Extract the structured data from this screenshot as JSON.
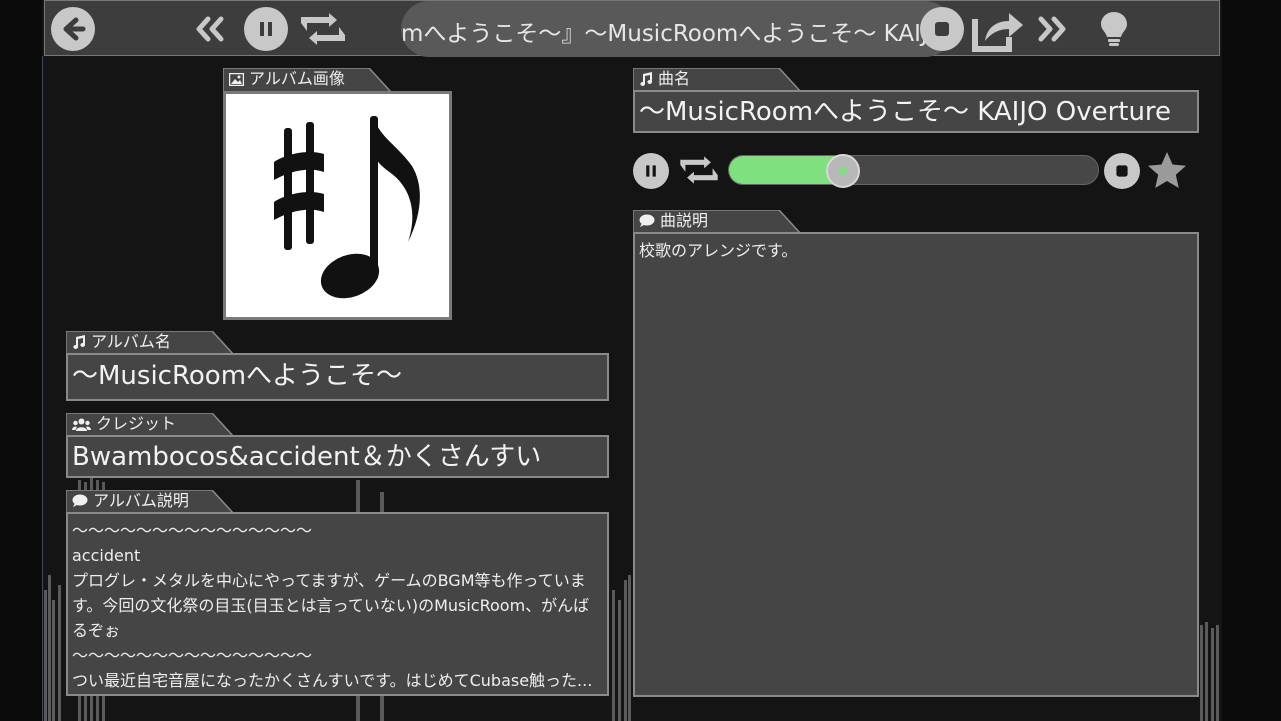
{
  "toolbar": {
    "back_icon": "back-arrow-icon",
    "rewind_icon": "double-chevron-left-icon",
    "pause_icon": "pause-icon",
    "repeat_icon": "repeat-icon",
    "stop_icon": "stop-icon",
    "share_icon": "share-icon",
    "forward_icon": "double-chevron-right-icon",
    "hint_icon": "lightbulb-icon",
    "marquee_text": "mへようこそ〜』〜MusicRoomへようこそ〜 KAIJO Overture"
  },
  "album_image": {
    "label": "アルバム画像",
    "icon": "image-icon"
  },
  "album_name": {
    "label": "アルバム名",
    "icon": "music-note-icon",
    "value": "〜MusicRoomへようこそ〜"
  },
  "credit": {
    "label": "クレジット",
    "icon": "users-icon",
    "value": "Bwambocos&accident＆かくさんすい"
  },
  "album_desc": {
    "label": "アルバム説明",
    "icon": "comment-icon",
    "lines": [
      "〜〜〜〜〜〜〜〜〜〜〜〜〜〜〜",
      "accident",
      "プログレ・メタルを中心にやってますが、ゲームのBGM等も作っていま",
      "す。今回の文化祭の目玉(目玉とは言っていない)のMusicRoom、がんば",
      "るぞぉ",
      "〜〜〜〜〜〜〜〜〜〜〜〜〜〜〜",
      "つい最近自宅音屋になったかくさんすいです。はじめてCubase触った..."
    ]
  },
  "song": {
    "label": "曲名",
    "icon": "music-note-icon",
    "value": "〜MusicRoomへようこそ〜 KAIJO Overture"
  },
  "player": {
    "progress": 0.31,
    "accent": "#7fe07f",
    "pause_icon": "pause-icon",
    "repeat_icon": "repeat-icon",
    "stop_icon": "stop-icon",
    "favorite_icon": "star-icon"
  },
  "song_desc": {
    "label": "曲説明",
    "icon": "comment-icon",
    "value": "校歌のアレンジです。"
  }
}
